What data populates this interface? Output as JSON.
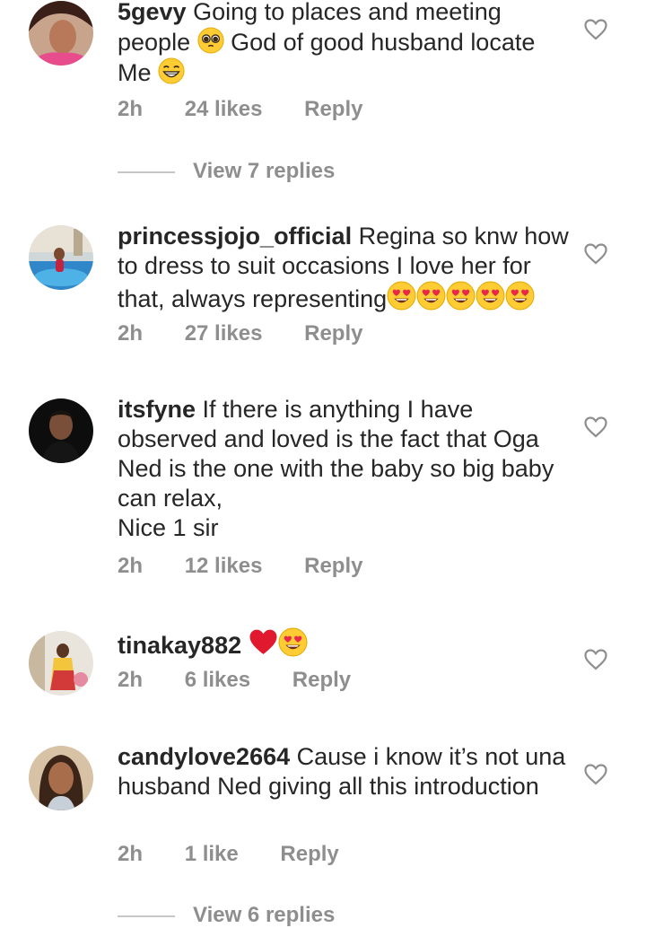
{
  "comments": [
    {
      "username": "5gevy",
      "text_parts": [
        "Going to places and meeting people ",
        " God of good husband locate Me "
      ],
      "emojis": [
        "pleading-face-emoji",
        "grinning-face-emoji"
      ],
      "time": "2h",
      "likes": "24 likes",
      "reply": "Reply",
      "view_replies": "View 7 replies"
    },
    {
      "username": "princessjojo_official",
      "text": "Regina so knw how to dress to suit occasions I love her for that, always representing",
      "emojis": [
        "heart-eyes-emoji",
        "heart-eyes-emoji",
        "heart-eyes-emoji",
        "heart-eyes-emoji",
        "heart-eyes-emoji"
      ],
      "time": "2h",
      "likes": "27 likes",
      "reply": "Reply"
    },
    {
      "username": "itsfyne",
      "text": "If there is anything I have observed and loved is the fact that Oga Ned is the one with the baby so big baby can relax,",
      "text_line2": "Nice 1 sir",
      "time": "2h",
      "likes": "12 likes",
      "reply": "Reply"
    },
    {
      "username": "tinakay882",
      "emojis": [
        "red-heart-emoji",
        "heart-eyes-emoji"
      ],
      "time": "2h",
      "likes": "6 likes",
      "reply": "Reply"
    },
    {
      "username": "candylove2664",
      "text": "Cause i know it’s not una husband Ned giving all this introduction",
      "time": "2h",
      "likes": "1 like",
      "reply": "Reply",
      "view_replies": "View 6 replies"
    }
  ],
  "colors": {
    "text": "#262626",
    "meta": "#8e8e8e",
    "divider": "#c7c7c7",
    "heart_outline": "#8e8e8e"
  }
}
